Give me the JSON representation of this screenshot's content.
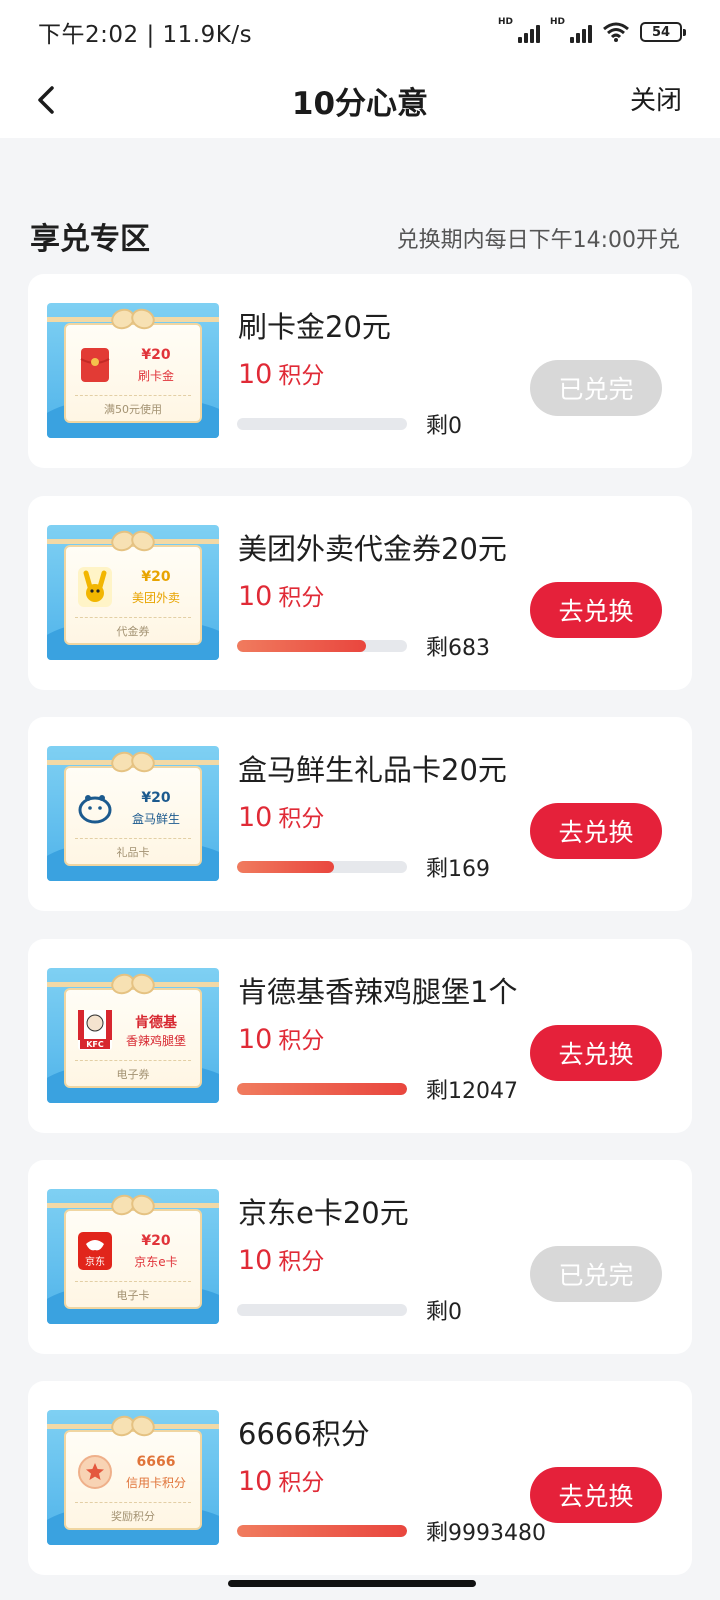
{
  "status_bar": {
    "time_speed": "下午2:02 | 11.9K/s",
    "hd_label": "HD",
    "battery": "54"
  },
  "nav": {
    "title": "10分心意",
    "close_label": "关闭"
  },
  "section": {
    "title": "享兑专区",
    "note": "兑换期内每日下午14:00开兑"
  },
  "colors": {
    "accent_red": "#e5213a",
    "points_red": "#e02a36",
    "disabled_gray": "#d8d8d8"
  },
  "products": [
    {
      "title": "刷卡金20元",
      "points": "10",
      "points_unit": "积分",
      "remaining": "剩0",
      "progress_fraction": 0,
      "button_label": "已兑完",
      "button_enabled": false,
      "thumb": {
        "logo": "red-envelope-icon",
        "value": "¥20",
        "name": "刷卡金",
        "footer": "满50元使用",
        "name_color": "#e0343a"
      }
    },
    {
      "title": "美团外卖代金券20元",
      "points": "10",
      "points_unit": "积分",
      "remaining": "剩683",
      "progress_fraction": 0.76,
      "button_label": "去兑换",
      "button_enabled": true,
      "thumb": {
        "logo": "meituan-kangaroo-icon",
        "value": "¥20",
        "name": "美团外卖",
        "footer": "代金券",
        "name_color": "#e8a400"
      }
    },
    {
      "title": "盒马鲜生礼品卡20元",
      "points": "10",
      "points_unit": "积分",
      "remaining": "剩169",
      "progress_fraction": 0.57,
      "button_label": "去兑换",
      "button_enabled": true,
      "thumb": {
        "logo": "hema-hippo-icon",
        "value": "¥20",
        "name": "盒马鲜生",
        "footer": "礼品卡",
        "name_color": "#1c5a8e"
      }
    },
    {
      "title": "肯德基香辣鸡腿堡1个",
      "points": "10",
      "points_unit": "积分",
      "remaining": "剩12047",
      "progress_fraction": 1.0,
      "button_label": "去兑换",
      "button_enabled": true,
      "thumb": {
        "logo": "kfc-logo-icon",
        "logo_text": "KFC",
        "value": "肯德基",
        "name": "香辣鸡腿堡",
        "footer": "电子券",
        "name_color": "#d7262f"
      }
    },
    {
      "title": "京东e卡20元",
      "points": "10",
      "points_unit": "积分",
      "remaining": "剩0",
      "progress_fraction": 0,
      "button_label": "已兑完",
      "button_enabled": false,
      "thumb": {
        "logo": "jd-dog-icon",
        "logo_text": "京东",
        "value": "¥20",
        "name": "京东e卡",
        "footer": "电子卡",
        "name_color": "#e0343a"
      }
    },
    {
      "title": "6666积分",
      "points": "10",
      "points_unit": "积分",
      "remaining": "剩9993480",
      "progress_fraction": 1.0,
      "button_label": "去兑换",
      "button_enabled": true,
      "thumb": {
        "logo": "star-medal-icon",
        "value": "6666",
        "name": "信用卡积分",
        "footer": "奖励积分",
        "name_color": "#e0743a"
      }
    }
  ]
}
